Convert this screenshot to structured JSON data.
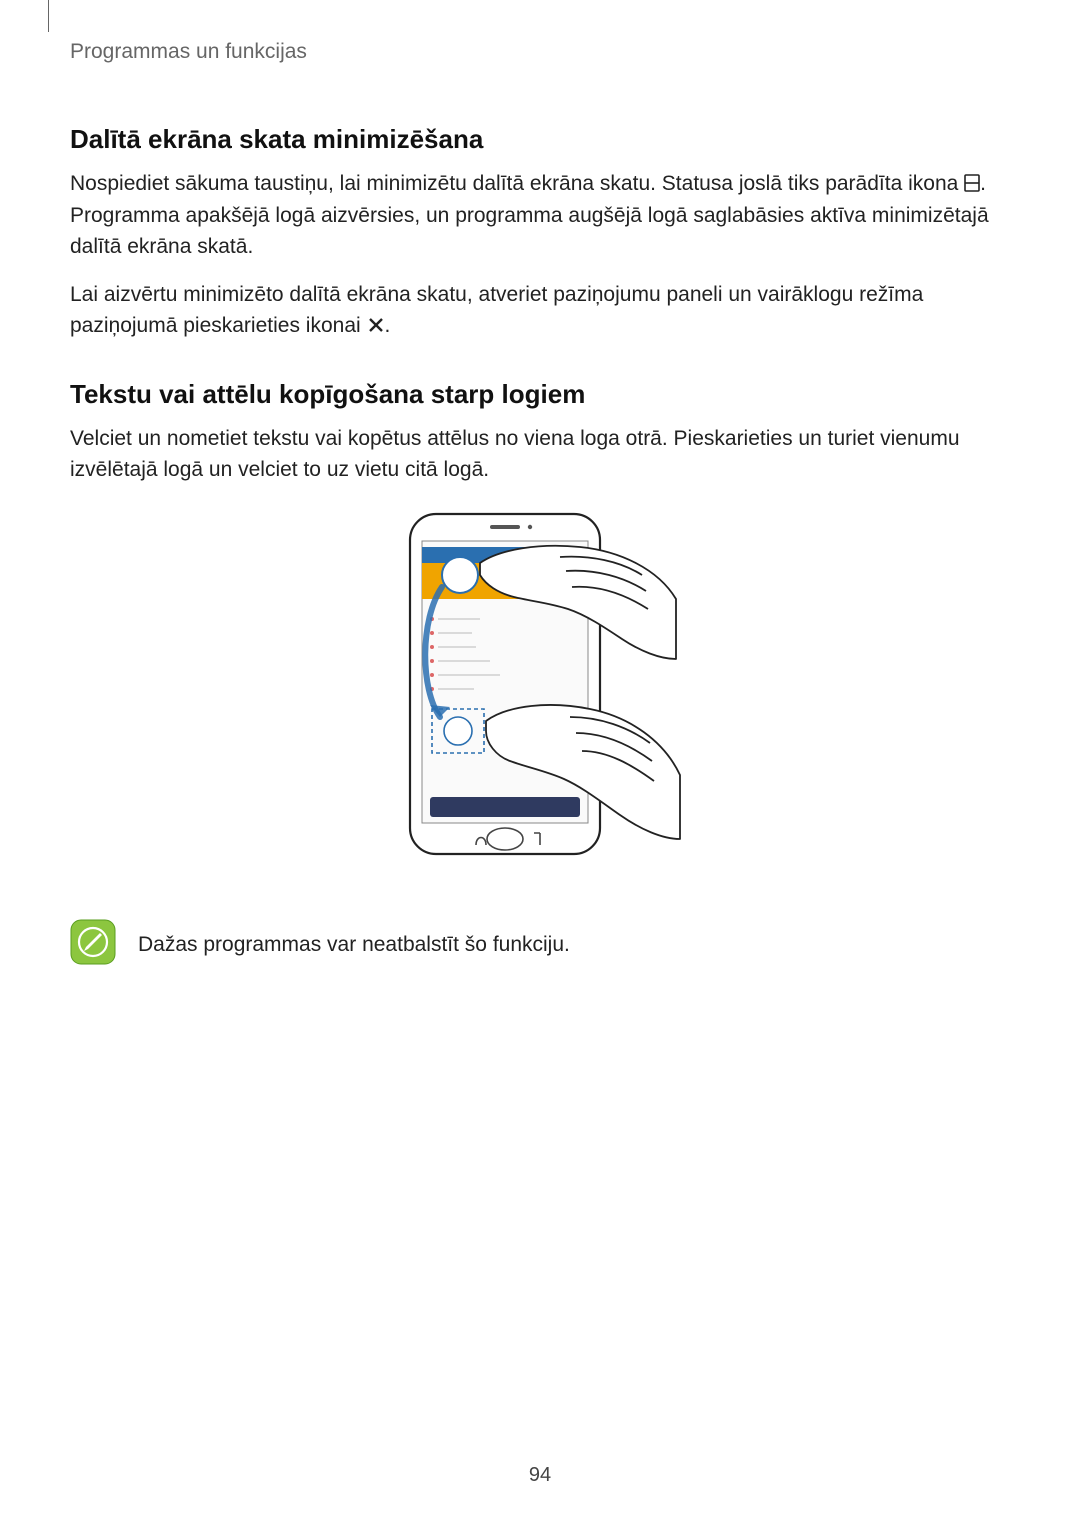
{
  "header": {
    "running_head": "Programmas un funkcijas"
  },
  "section1": {
    "heading": "Dalītā ekrāna skata minimizēšana",
    "p1a": "Nospiediet sākuma taustiņu, lai minimizētu dalītā ekrāna skatu. Statusa joslā tiks parādīta ikona ",
    "p1b": ". Programma apakšējā logā aizvērsies, un programma augšējā logā saglabāsies aktīva minimizētajā dalītā ekrāna skatā.",
    "p2a": "Lai aizvērtu minimizēto dalītā ekrāna skatu, atveriet paziņojumu paneli un vairāklogu režīma paziņojumā pieskarieties ikonai ",
    "p2b": "."
  },
  "section2": {
    "heading": "Tekstu vai attēlu kopīgošana starp logiem",
    "p1": "Velciet un nometiet tekstu vai kopētus attēlus no viena loga otrā. Pieskarieties un turiet vienumu izvēlētajā logā un velciet to uz vietu citā logā."
  },
  "note": {
    "text": "Dažas programmas var neatbalstīt šo funkciju."
  },
  "page_number": "94",
  "icons": {
    "split_screen": "split-screen-icon",
    "close_x": "close-icon",
    "note_pen": "note-pen-icon"
  }
}
